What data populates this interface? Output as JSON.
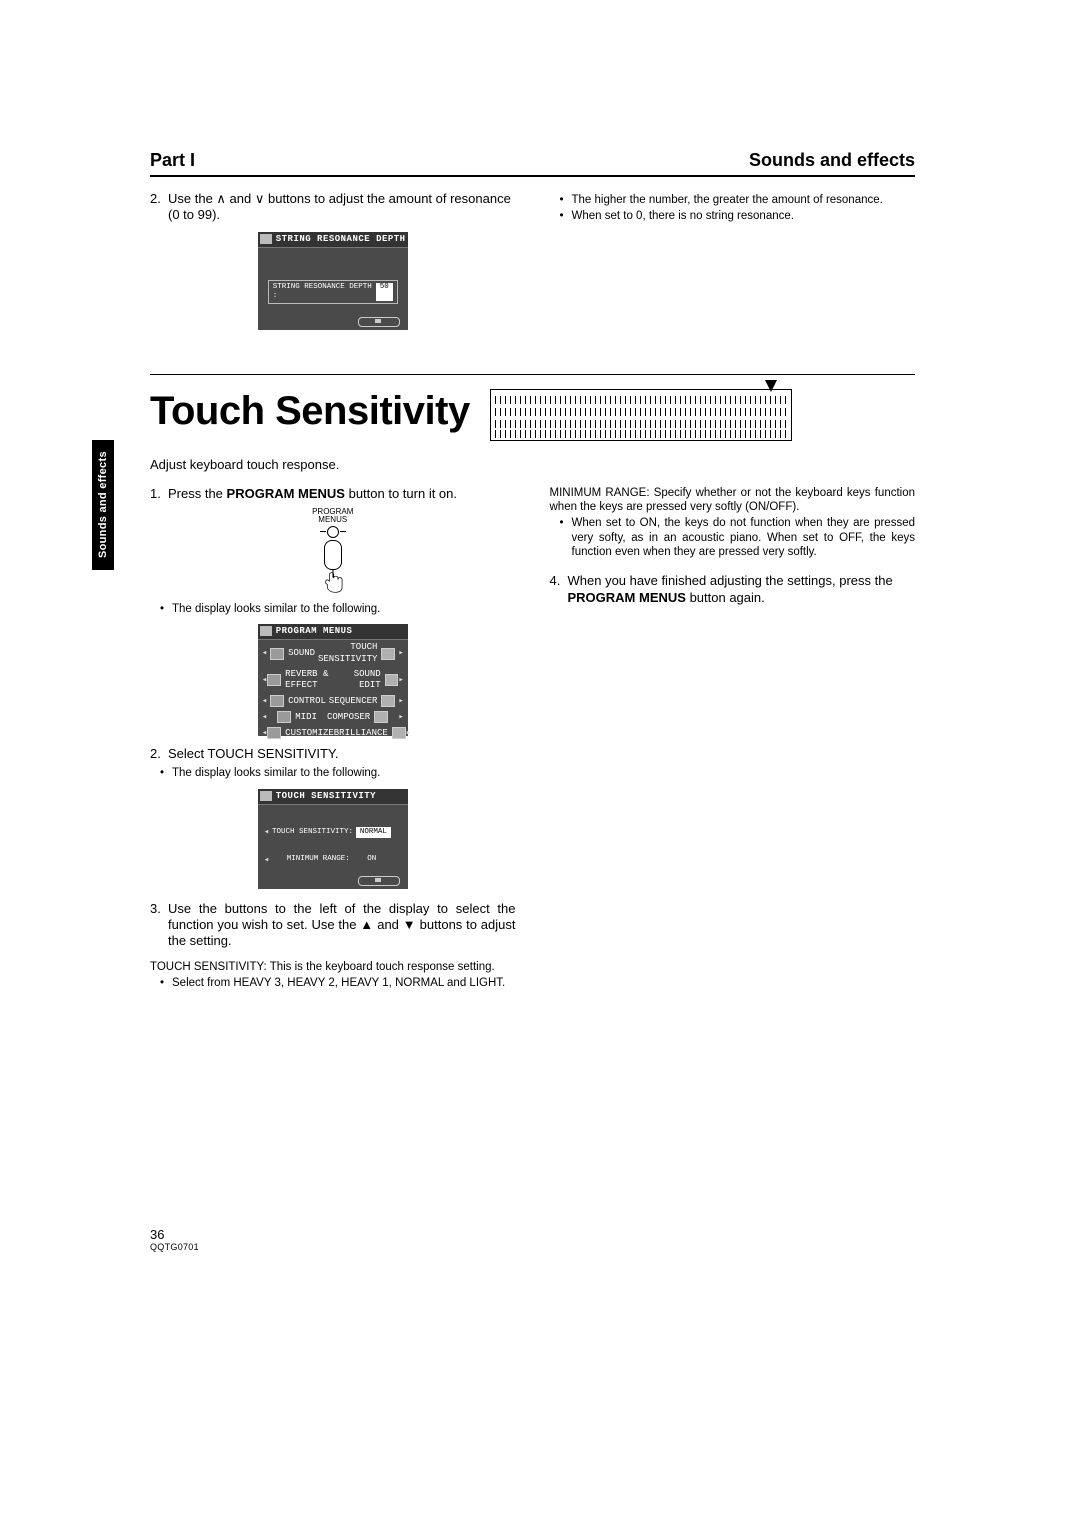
{
  "header": {
    "part": "Part I",
    "section": "Sounds and effects"
  },
  "side_tab": "Sounds and effects",
  "resonance": {
    "step_num": "2.",
    "step_text_a": "Use the ",
    "step_text_b": " and ",
    "step_text_c": " buttons to adjust the amount of resonance (0 to 99).",
    "screen_title": "STRING RESONANCE DEPTH",
    "field_label": "STRING RESONANCE DEPTH :",
    "field_value": "50",
    "notes": [
      "The higher the number, the greater the amount of resonance.",
      "When set to 0, there is no string resonance."
    ]
  },
  "touch": {
    "title": "Touch Sensitivity",
    "intro": "Adjust keyboard touch response.",
    "step1_num": "1.",
    "step1_text_a": "Press the ",
    "step1_bold": "PROGRAM MENUS",
    "step1_text_b": " button to turn it on.",
    "program_menus_label_top": "PROGRAM",
    "program_menus_label_bottom": "MENUS",
    "display_note": "The display looks similar to the following.",
    "menus_screen_title": "PROGRAM MENUS",
    "menus": {
      "left": [
        "SOUND",
        "REVERB &\nEFFECT",
        "CONTROL",
        "MIDI",
        "CUSTOMIZE"
      ],
      "right": [
        "TOUCH\nSENSITIVITY",
        "SOUND EDIT",
        "SEQUENCER",
        "COMPOSER",
        "BRILLIANCE"
      ]
    },
    "step2_num": "2.",
    "step2_text": "Select TOUCH SENSITIVITY.",
    "display_note2": "The display looks similar to the following.",
    "touch_screen_title": "TOUCH SENSITIVITY",
    "touch_row1_label": "TOUCH SENSITIVITY:",
    "touch_row1_value": "NORMAL",
    "touch_row2_label": "MINIMUM RANGE:",
    "touch_row2_value": "ON",
    "step3_num": "3.",
    "step3_text": "Use the buttons to the left of the display to select the function you wish to set. Use the ▲ and ▼ buttons to adjust the setting.",
    "note_touch_sens": "TOUCH SENSITIVITY: This is the keyboard touch response setting.",
    "note_touch_sens_sub": "Select from HEAVY 3, HEAVY 2, HEAVY 1, NORMAL and LIGHT.",
    "note_min_range": "MINIMUM RANGE: Specify whether or not the keyboard keys function when the keys are pressed very softly (ON/OFF).",
    "note_min_range_sub": "When set to ON, the keys do not function when they are pressed very softy, as in an acoustic piano. When set to OFF, the keys function even when they are pressed very softly.",
    "step4_num": "4.",
    "step4_text_a": "When you have finished adjusting the settings, press the ",
    "step4_bold": "PROGRAM MENUS",
    "step4_text_b": " button again."
  },
  "footer": {
    "page": "36",
    "code": "QQTG0701"
  }
}
